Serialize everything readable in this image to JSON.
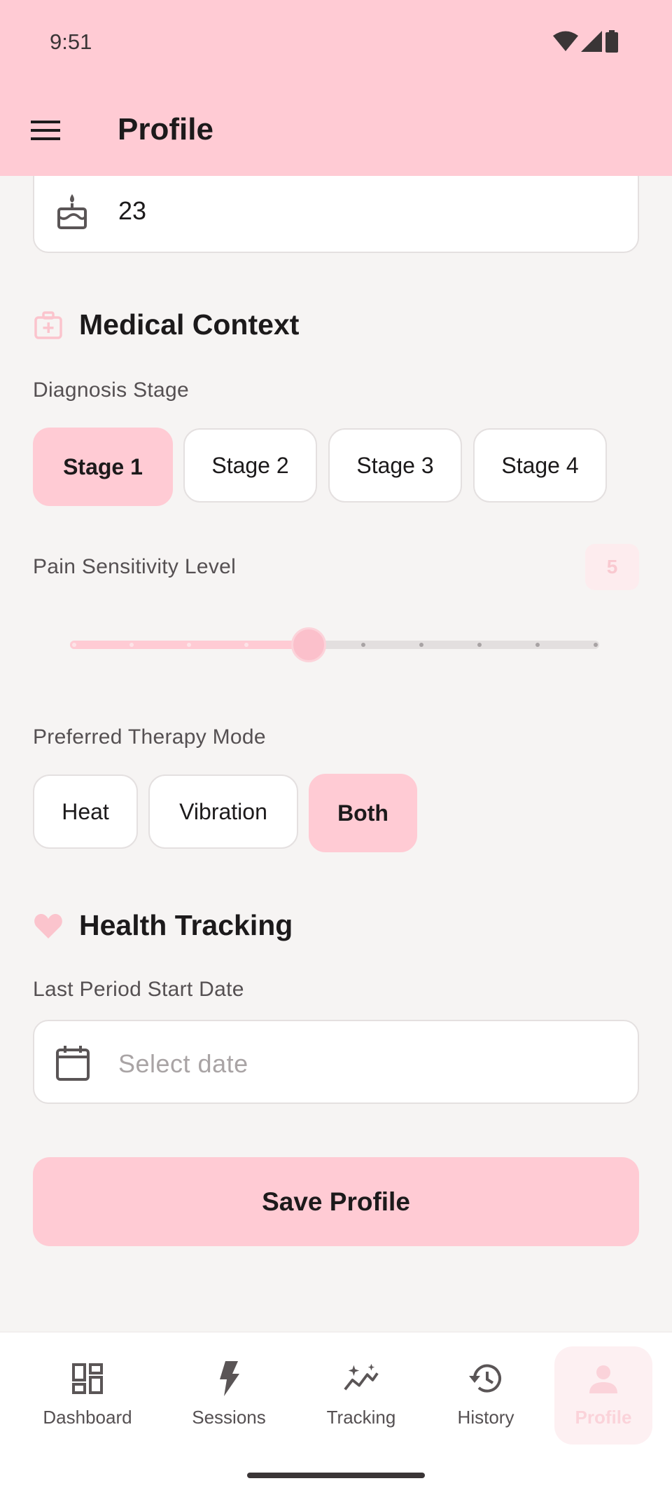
{
  "status_bar": {
    "time": "9:51"
  },
  "app_bar": {
    "title": "Profile",
    "menu_icon": "hamburger-menu-icon"
  },
  "age": {
    "value": "23",
    "icon": "cake-icon"
  },
  "medical_context": {
    "title": "Medical Context",
    "icon": "medical-bag-icon",
    "diagnosis_stage": {
      "label": "Diagnosis Stage",
      "options": [
        "Stage 1",
        "Stage 2",
        "Stage 3",
        "Stage 4"
      ],
      "selected": "Stage 1"
    },
    "pain_sensitivity": {
      "label": "Pain Sensitivity Level",
      "value": "5",
      "min": 1,
      "max": 10
    },
    "therapy_mode": {
      "label": "Preferred Therapy Mode",
      "options": [
        "Heat",
        "Vibration",
        "Both"
      ],
      "selected": "Both"
    }
  },
  "health_tracking": {
    "title": "Health Tracking",
    "icon": "heart-icon",
    "last_period": {
      "label": "Last Period Start Date",
      "placeholder": "Select date",
      "icon": "calendar-icon"
    }
  },
  "save_button": {
    "label": "Save Profile"
  },
  "bottom_nav": {
    "items": [
      {
        "label": "Dashboard",
        "icon": "dashboard-icon"
      },
      {
        "label": "Sessions",
        "icon": "bolt-icon"
      },
      {
        "label": "Tracking",
        "icon": "sparkle-chart-icon"
      },
      {
        "label": "History",
        "icon": "history-icon"
      },
      {
        "label": "Profile",
        "icon": "person-icon"
      }
    ],
    "active": "Profile"
  },
  "colors": {
    "accent": "#ffcbd4",
    "background": "#f6f4f3",
    "text": "#1c1a1b",
    "muted_text": "#555052"
  }
}
